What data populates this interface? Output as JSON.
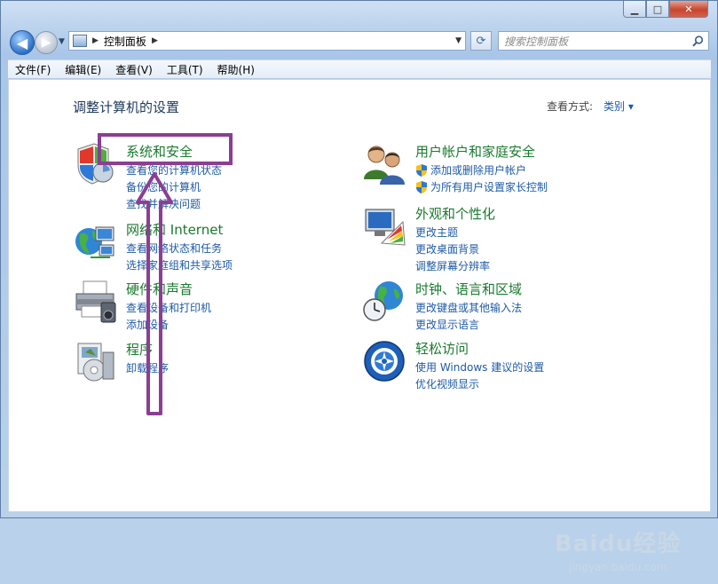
{
  "window": {
    "controls": {
      "minimize": "▁",
      "maximize": "□",
      "close": "✕"
    }
  },
  "nav": {
    "breadcrumb": "控制面板",
    "search_placeholder": "搜索控制面板"
  },
  "menu": [
    "文件(F)",
    "编辑(E)",
    "查看(V)",
    "工具(T)",
    "帮助(H)"
  ],
  "content": {
    "title": "调整计算机的设置",
    "view_by_label": "查看方式:",
    "view_by_value": "类别 ▾",
    "categories": [
      {
        "title": "系统和安全",
        "links": [
          "查看您的计算机状态",
          "备份您的计算机",
          "查找并解决问题"
        ],
        "icon": "shield-icon"
      },
      {
        "title": "网络和 Internet",
        "links": [
          "查看网络状态和任务",
          "选择家庭组和共享选项"
        ],
        "icon": "network-globe-icon"
      },
      {
        "title": "硬件和声音",
        "links": [
          "查看设备和打印机",
          "添加设备"
        ],
        "icon": "printer-icon"
      },
      {
        "title": "程序",
        "links": [
          "卸载程序"
        ],
        "icon": "programs-icon"
      },
      {
        "title": "用户帐户和家庭安全",
        "links": [
          "添加或删除用户帐户",
          "为所有用户设置家长控制"
        ],
        "icon": "users-icon"
      },
      {
        "title": "外观和个性化",
        "links": [
          "更改主题",
          "更改桌面背景",
          "调整屏幕分辨率"
        ],
        "icon": "monitor-palette-icon"
      },
      {
        "title": "时钟、语言和区域",
        "links": [
          "更改键盘或其他输入法",
          "更改显示语言"
        ],
        "icon": "clock-globe-icon"
      },
      {
        "title": "轻松访问",
        "links": [
          "使用 Windows 建议的设置",
          "优化视频显示"
        ],
        "icon": "ease-of-access-icon"
      }
    ]
  },
  "annotation": {
    "color": "#8b3e93"
  },
  "watermark": {
    "text": "Baidu经验",
    "sub": "jingyan.baidu.com"
  }
}
